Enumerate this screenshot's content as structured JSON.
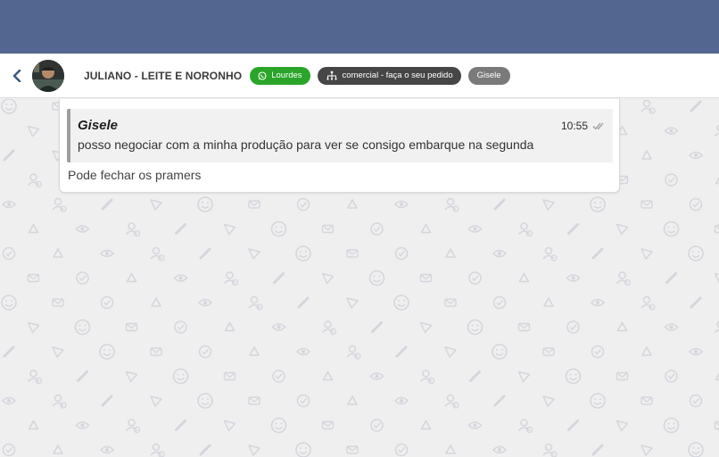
{
  "header": {
    "contact_name": "JULIANO - LEITE E NORONHO",
    "tags": {
      "whatsapp": "Lourdes",
      "queue": "comercial - faça o seu pedido",
      "user": "Gisele"
    }
  },
  "message": {
    "quoted": {
      "author": "Gisele",
      "time": "10:55",
      "text": "posso negociar com a minha produção para ver se consigo embarque na segunda"
    },
    "text": "Pode fechar os pramers"
  },
  "colors": {
    "topbar": "#52668f",
    "whatsapp_tag": "#2aa52a",
    "queue_tag": "#464646",
    "user_tag": "#7a7a7a",
    "chat_background": "#efefef"
  },
  "icons": {
    "back": "chevron-left-icon",
    "whatsapp": "whatsapp-icon",
    "queue": "network-icon",
    "read_status": "double-check-icon"
  }
}
